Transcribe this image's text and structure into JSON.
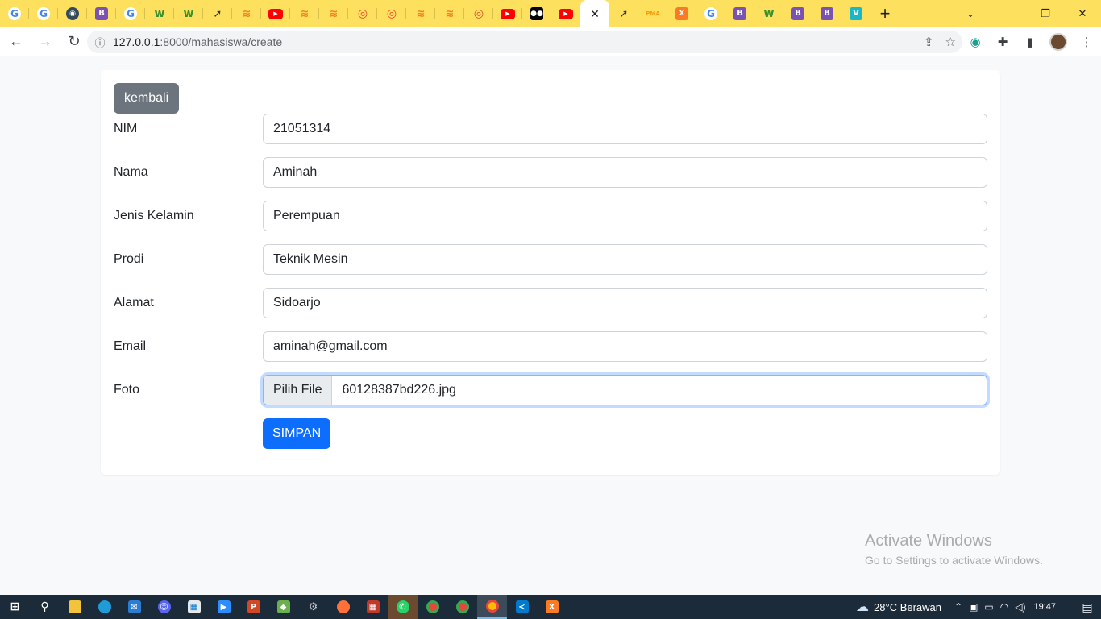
{
  "browser": {
    "tabs": [
      {
        "name": "tab-google-1",
        "icon": "google-icon",
        "glyph": "G",
        "cls": "g"
      },
      {
        "name": "tab-google-2",
        "icon": "google-icon",
        "glyph": "G",
        "cls": "g"
      },
      {
        "name": "tab-signal",
        "icon": "signal-icon",
        "glyph": "◉",
        "cls": "sig"
      },
      {
        "name": "tab-bootstrap-1",
        "icon": "bootstrap-icon",
        "glyph": "B",
        "cls": "b"
      },
      {
        "name": "tab-google-3",
        "icon": "google-icon",
        "glyph": "G",
        "cls": "g"
      },
      {
        "name": "tab-w3-1",
        "icon": "w3schools-icon",
        "glyph": "w",
        "cls": "w"
      },
      {
        "name": "tab-w3-2",
        "icon": "w3schools-icon",
        "glyph": "w",
        "cls": "w"
      },
      {
        "name": "tab-plane-1",
        "icon": "paper-plane-icon",
        "glyph": "➚",
        "cls": "plane"
      },
      {
        "name": "tab-stackoverflow-1",
        "icon": "stackoverflow-icon",
        "glyph": "≋",
        "cls": "so"
      },
      {
        "name": "tab-youtube-1",
        "icon": "youtube-icon",
        "glyph": "▶",
        "cls": "yt"
      },
      {
        "name": "tab-stackoverflow-2",
        "icon": "stackoverflow-icon",
        "glyph": "≋",
        "cls": "so"
      },
      {
        "name": "tab-stackoverflow-3",
        "icon": "stackoverflow-icon",
        "glyph": "≋",
        "cls": "so"
      },
      {
        "name": "tab-wifi-1",
        "icon": "wifi-icon",
        "glyph": "◎",
        "cls": "wifi"
      },
      {
        "name": "tab-wifi-2",
        "icon": "wifi-icon",
        "glyph": "◎",
        "cls": "wifi"
      },
      {
        "name": "tab-stackoverflow-4",
        "icon": "stackoverflow-icon",
        "glyph": "≋",
        "cls": "so"
      },
      {
        "name": "tab-stackoverflow-5",
        "icon": "stackoverflow-icon",
        "glyph": "≋",
        "cls": "so"
      },
      {
        "name": "tab-wifi-3",
        "icon": "wifi-icon",
        "glyph": "◎",
        "cls": "wifi"
      },
      {
        "name": "tab-youtube-2",
        "icon": "youtube-icon",
        "glyph": "▶",
        "cls": "yt"
      },
      {
        "name": "tab-medium",
        "icon": "medium-icon",
        "glyph": "●●",
        "cls": "med"
      },
      {
        "name": "tab-youtube-3",
        "icon": "youtube-icon",
        "glyph": "▶",
        "cls": "yt"
      },
      {
        "name": "tab-active",
        "icon": "close-icon",
        "glyph": "✕",
        "cls": "active"
      },
      {
        "name": "tab-plane-2",
        "icon": "paper-plane-icon",
        "glyph": "➚",
        "cls": "plane"
      },
      {
        "name": "tab-phpmyadmin",
        "icon": "phpmyadmin-icon",
        "glyph": "PMA",
        "cls": "pma"
      },
      {
        "name": "tab-xampp",
        "icon": "xampp-icon",
        "glyph": "X",
        "cls": "xamp"
      },
      {
        "name": "tab-google-4",
        "icon": "google-icon",
        "glyph": "G",
        "cls": "g"
      },
      {
        "name": "tab-bootstrap-2",
        "icon": "bootstrap-icon",
        "glyph": "B",
        "cls": "b"
      },
      {
        "name": "tab-w3-3",
        "icon": "w3schools-icon",
        "glyph": "w",
        "cls": "w"
      },
      {
        "name": "tab-bootstrap-3",
        "icon": "bootstrap-icon",
        "glyph": "B",
        "cls": "b"
      },
      {
        "name": "tab-bootstrap-4",
        "icon": "bootstrap-icon",
        "glyph": "B",
        "cls": "b"
      },
      {
        "name": "tab-vuetify",
        "icon": "vuetify-icon",
        "glyph": "V",
        "cls": "v"
      }
    ],
    "url_host": "127.0.0.1",
    "url_path": ":8000/mahasiswa/create"
  },
  "form": {
    "back_label": "kembali",
    "fields": [
      {
        "label": "NIM",
        "value": "21051314"
      },
      {
        "label": "Nama",
        "value": "Aminah"
      },
      {
        "label": "Jenis Kelamin",
        "value": "Perempuan"
      },
      {
        "label": "Prodi",
        "value": "Teknik Mesin"
      },
      {
        "label": "Alamat",
        "value": "Sidoarjo"
      },
      {
        "label": "Email",
        "value": "aminah@gmail.com"
      }
    ],
    "photo_label": "Foto",
    "file_button": "Pilih File",
    "file_name": "60128387bd226.jpg",
    "save_label": "SIMPAN"
  },
  "watermark": {
    "title": "Activate Windows",
    "subtitle": "Go to Settings to activate Windows."
  },
  "taskbar": {
    "weather": "28°C  Berawan",
    "time": "19:47"
  },
  "colors": {
    "tab_strip": "#fde15e",
    "primary": "#0d6efd",
    "secondary": "#6c757d",
    "taskbar": "#1c2b3a"
  }
}
